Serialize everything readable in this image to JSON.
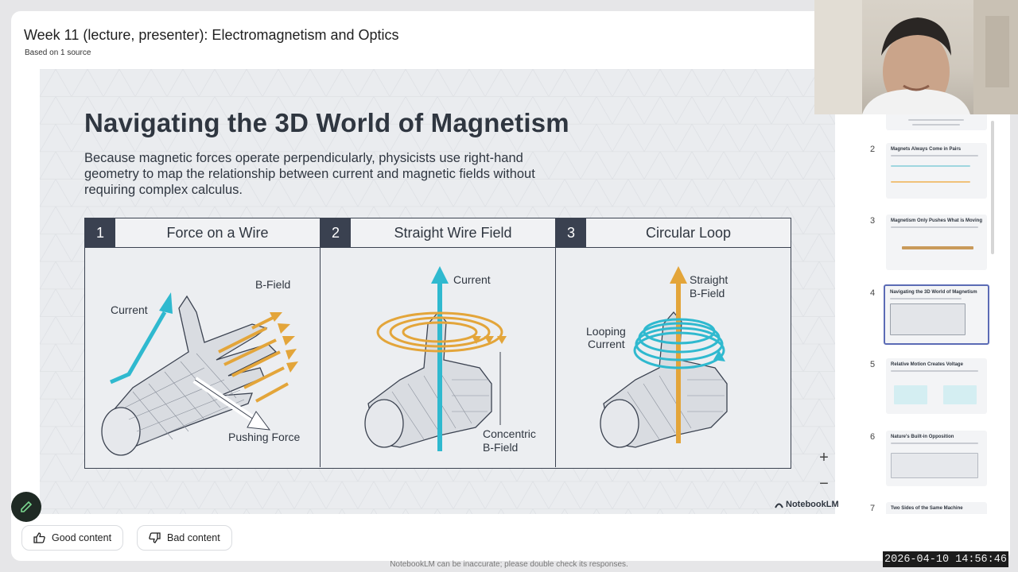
{
  "header": {
    "title": "Week 11 (lecture, presenter): Electromagnetism and Optics",
    "subtitle": "Based on 1 source"
  },
  "slide": {
    "title": "Navigating the 3D World of Magnetism",
    "description": "Because magnetic forces operate perpendicularly, physicists use right-hand geometry to map the relationship between current and magnetic fields without requiring complex calculus.",
    "columns": [
      {
        "number": "1",
        "heading": "Force on a Wire",
        "labels": {
          "current": "Current",
          "bfield": "B-Field",
          "force": "Pushing Force"
        }
      },
      {
        "number": "2",
        "heading": "Straight Wire Field",
        "labels": {
          "current": "Current",
          "concentric": "Concentric",
          "bfield": "B-Field"
        }
      },
      {
        "number": "3",
        "heading": "Circular Loop",
        "labels": {
          "straight": "Straight",
          "bfield": "B-Field",
          "looping": "Looping",
          "current": "Current"
        }
      }
    ],
    "watermark": "NotebookLM"
  },
  "zoom": {
    "in": "+",
    "out": "−"
  },
  "thumbnails": [
    {
      "number": "2",
      "title": "Magnets Always Come in Pairs"
    },
    {
      "number": "3",
      "title": "Magnetism Only Pushes What is Moving"
    },
    {
      "number": "4",
      "title": "Navigating the 3D World of Magnetism",
      "active": true
    },
    {
      "number": "5",
      "title": "Relative Motion Creates Voltage"
    },
    {
      "number": "6",
      "title": "Nature's Built-in Opposition"
    },
    {
      "number": "7",
      "title": "Two Sides of the Same Machine"
    }
  ],
  "feedback": {
    "good": "Good content",
    "bad": "Bad content"
  },
  "footer": "NotebookLM can be inaccurate; please double check its responses.",
  "timestamp": "2026-04-10 14:56:46",
  "colors": {
    "accent": "#5b6bb5",
    "wire_orange": "#e3a53a",
    "cyan": "#2fb9cf",
    "navy": "#3a4150"
  }
}
